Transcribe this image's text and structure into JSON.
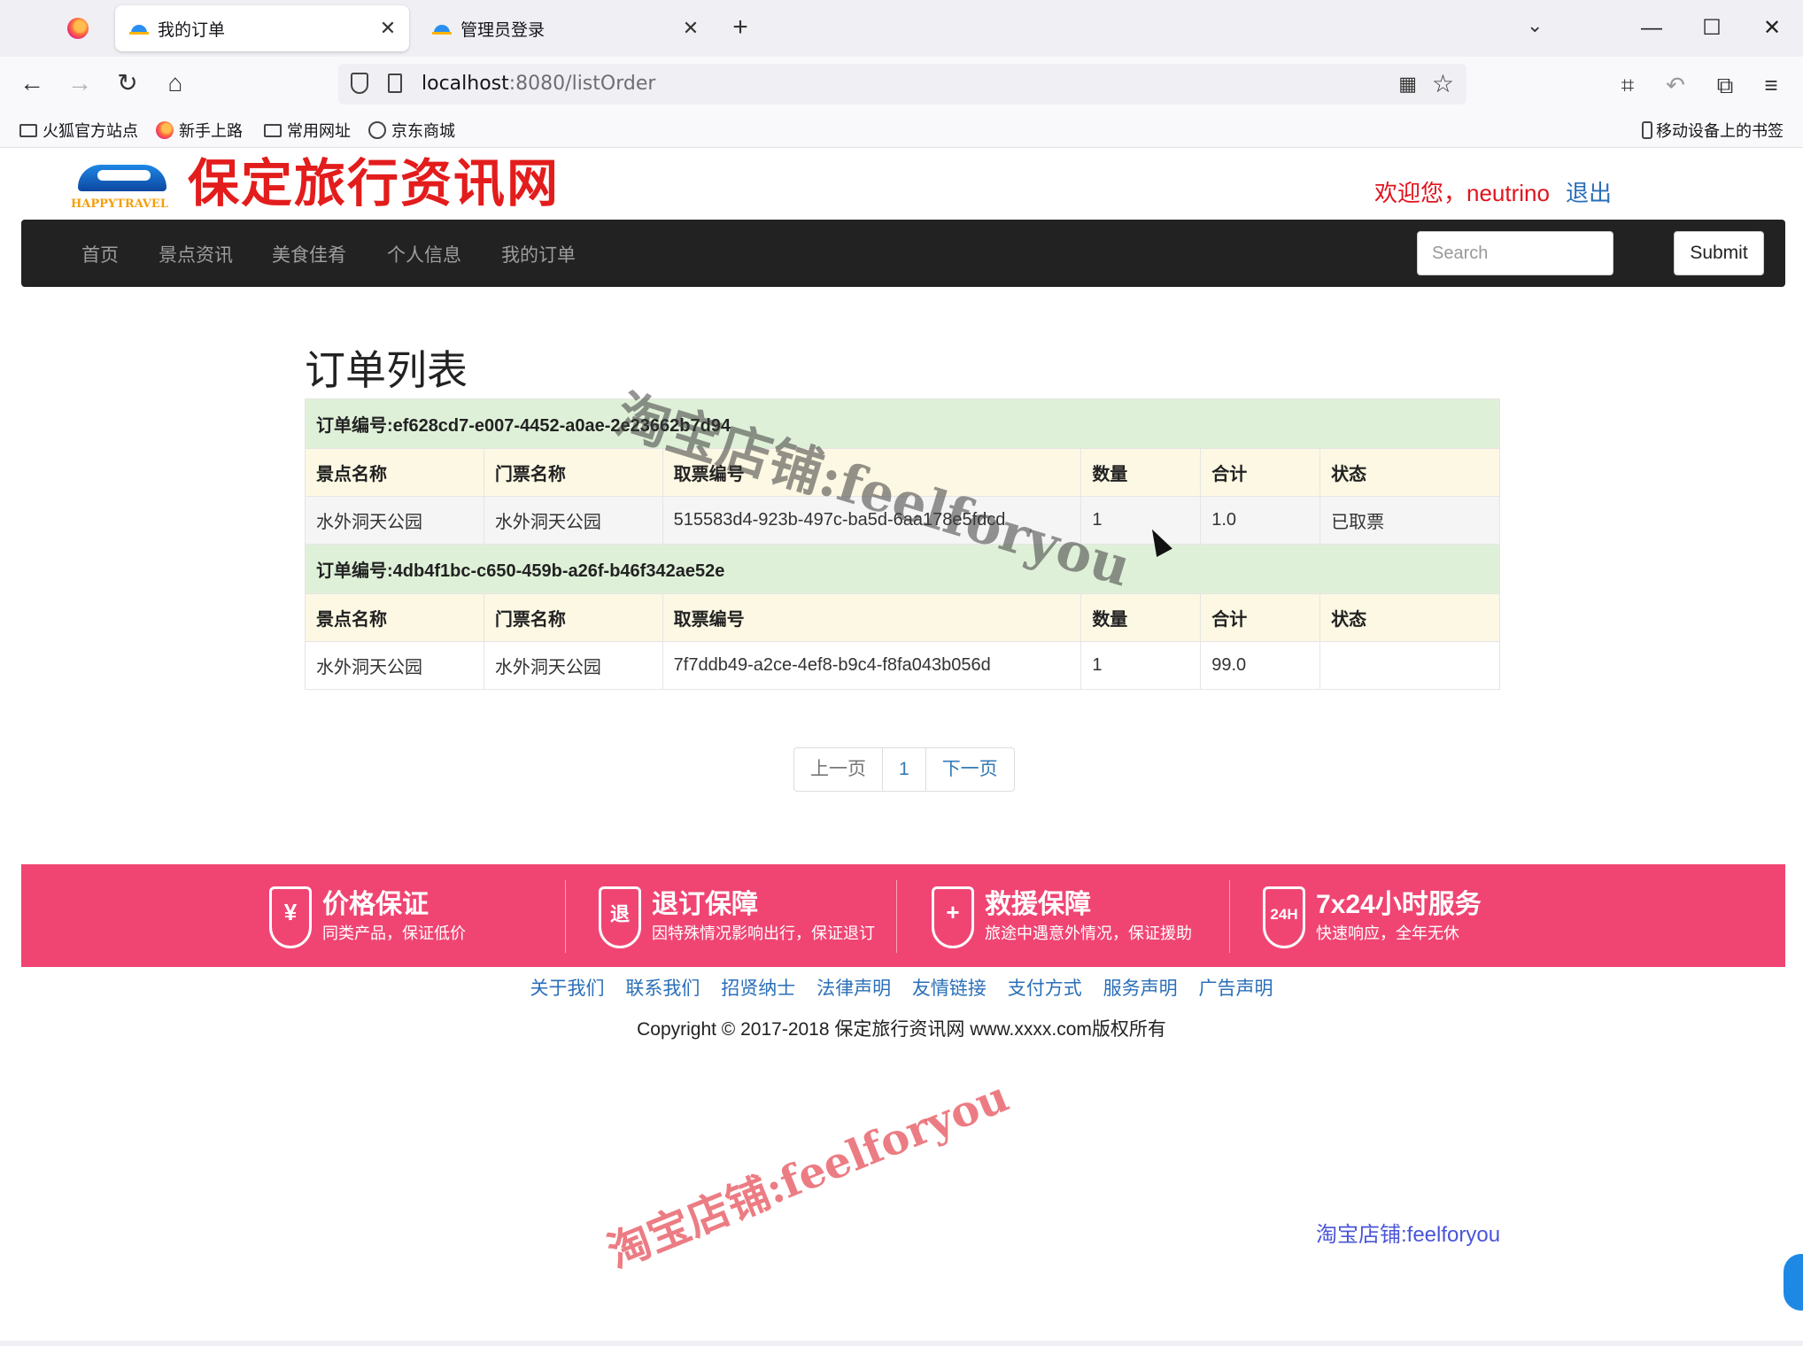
{
  "browser": {
    "tabs": [
      {
        "title": "我的订单",
        "active": true
      },
      {
        "title": "管理员登录",
        "active": false
      }
    ],
    "url_host": "localhost",
    "url_path": ":8080/listOrder",
    "bookmarks": [
      "火狐官方站点",
      "新手上路",
      "常用网址",
      "京东商城"
    ],
    "mobile_bookmarks": "移动设备上的书签",
    "glyphs": {
      "close": "✕",
      "new_tab": "+",
      "tabs_list": "⌄",
      "minimize": "—",
      "maximize": "☐",
      "window_close": "✕",
      "back": "←",
      "forward": "→",
      "reload": "↻",
      "home": "⌂",
      "qr": "▦",
      "star": "☆",
      "crop": "⌗",
      "undo": "↶",
      "extension": "⧉",
      "menu": "≡"
    }
  },
  "site": {
    "logo_text": "HAPPYTRAVEL",
    "title": "保定旅行资讯网",
    "welcome": "欢迎您，neutrino",
    "logout": "退出",
    "nav": [
      "首页",
      "景点资讯",
      "美食佳肴",
      "个人信息",
      "我的订单"
    ],
    "search_placeholder": "Search",
    "submit": "Submit"
  },
  "main": {
    "page_title": "订单列表",
    "headers": [
      "景点名称",
      "门票名称",
      "取票编号",
      "数量",
      "合计",
      "状态"
    ],
    "orders": [
      {
        "order_label": "订单编号:ef628cd7-e007-4452-a0ae-2e23662b7d94",
        "items": [
          {
            "spot": "水外洞天公园",
            "ticket": "水外洞天公园",
            "code": "515583d4-923b-497c-ba5d-6aa178e5fdcd",
            "qty": "1",
            "total": "1.0",
            "status": "已取票"
          }
        ]
      },
      {
        "order_label": "订单编号:4db4f1bc-c650-459b-a26f-b46f342ae52e",
        "items": [
          {
            "spot": "水外洞天公园",
            "ticket": "水外洞天公园",
            "code": "7f7ddb49-a2ce-4ef8-b9c4-f8fa043b056d",
            "qty": "1",
            "total": "99.0",
            "status": ""
          }
        ]
      }
    ],
    "pager": {
      "prev": "上一页",
      "page": "1",
      "next": "下一页"
    }
  },
  "footer": {
    "features": [
      {
        "icon": "yen-shield-icon",
        "symbol": "¥",
        "title": "价格保证",
        "sub": "同类产品，保证低价"
      },
      {
        "icon": "refund-shield-icon",
        "symbol": "退",
        "title": "退订保障",
        "sub": "因特殊情况影响出行，保证退订"
      },
      {
        "icon": "firstaid-shield-icon",
        "symbol": "+",
        "title": "救援保障",
        "sub": "旅途中遇意外情况，保证援助"
      },
      {
        "icon": "24h-shield-icon",
        "symbol": "24H",
        "title": "7x24小时服务",
        "sub": "快速响应，全年无休"
      }
    ],
    "band_color": "#f04573",
    "links": [
      "关于我们",
      "联系我们",
      "招贤纳士",
      "法律声明",
      "友情链接",
      "支付方式",
      "服务声明",
      "广告声明"
    ],
    "copyright": "Copyright © 2017-2018 保定旅行资讯网 www.xxxx.com版权所有"
  },
  "watermarks": [
    "淘宝店铺:feelforyou",
    "淘宝店铺:feelforyou",
    "淘宝店铺:feelforyou"
  ]
}
